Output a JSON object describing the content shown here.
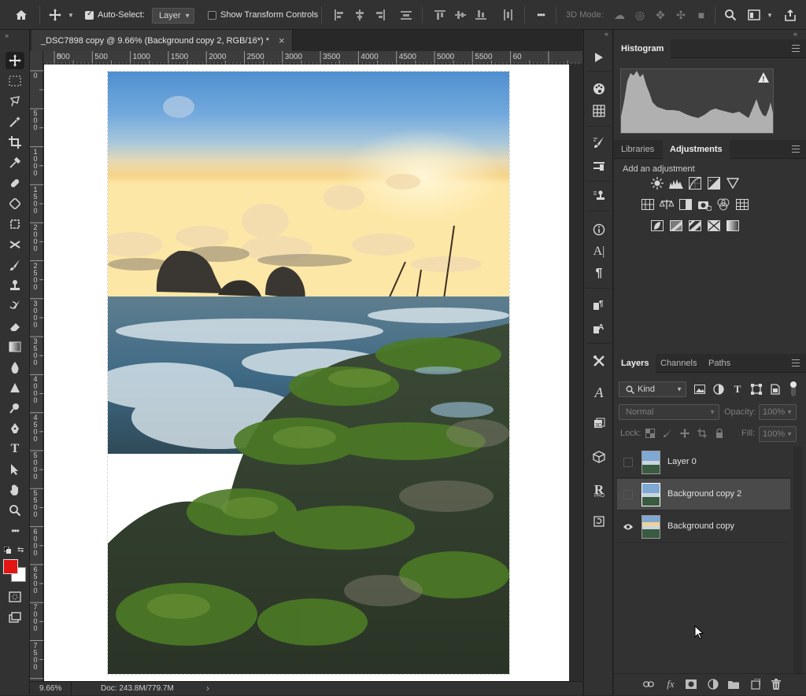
{
  "options_bar": {
    "auto_select_label": "Auto-Select:",
    "auto_select_value": "Layer",
    "show_transform_label": "Show Transform Controls",
    "mode_3d_label": "3D Mode:",
    "more_label": "•••"
  },
  "document": {
    "tab_title": "_DSC7898 copy @ 9.66% (Background copy 2, RGB/16*) *",
    "close_glyph": "×",
    "ruler_top_labels": [
      "500",
      "0",
      "500",
      "1000",
      "1500",
      "2000",
      "2500",
      "3000",
      "3500",
      "4000",
      "4500",
      "5000",
      "5500",
      "60"
    ],
    "ruler_left_labels": [
      "0",
      "5 0 0",
      "1 0 0 0",
      "1 5 0 0",
      "2 0 0 0",
      "2 5 0 0",
      "3 0 0 0",
      "3 5 0 0",
      "4 0 0 0",
      "4 5 0 0",
      "5 0 0 0",
      "5 5 0 0",
      "6 0 0 0",
      "6 5 0 0",
      "7 0 0 0",
      "7 5 0 0"
    ],
    "zoom": "9.66%",
    "doc_size": "Doc: 243.8M/779.7M",
    "status_arrow": "›"
  },
  "histogram": {
    "title": "Histogram",
    "warning_glyph": "!"
  },
  "adjustments": {
    "tab_libraries": "Libraries",
    "tab_adjustments": "Adjustments",
    "add_label": "Add an adjustment",
    "icons_row1": [
      "brightness-contrast-icon",
      "levels-icon",
      "curves-icon",
      "exposure-icon",
      "gradient-map-triangle-icon"
    ],
    "icons_row2": [
      "vibrance-icon",
      "color-balance-icon",
      "black-white-icon",
      "photo-filter-icon",
      "channel-mixer-icon",
      "color-lookup-icon"
    ],
    "icons_row3": [
      "invert-icon",
      "posterize-icon",
      "threshold-icon",
      "selective-color-icon",
      "gradient-map-icon"
    ]
  },
  "layers": {
    "tab_layers": "Layers",
    "tab_channels": "Channels",
    "tab_paths": "Paths",
    "kind_label": "Kind",
    "blend_mode": "Normal",
    "opacity_label": "Opacity:",
    "opacity_value": "100%",
    "lock_label": "Lock:",
    "fill_label": "Fill:",
    "fill_value": "100%",
    "items": [
      {
        "name": "Layer 0",
        "visible": false,
        "selected": false
      },
      {
        "name": "Background copy 2",
        "visible": false,
        "selected": true
      },
      {
        "name": "Background copy",
        "visible": true,
        "selected": false
      }
    ],
    "footer_icons": [
      "link-icon",
      "fx-icon",
      "mask-icon",
      "adjustment-layer-icon",
      "group-folder-icon",
      "new-layer-icon",
      "trash-icon"
    ],
    "fx_label": "fx"
  },
  "colors": {
    "foreground": "#e31414",
    "background": "#ffffff",
    "panel_bg": "#323232",
    "selected_layer": "#4a4a4a"
  }
}
